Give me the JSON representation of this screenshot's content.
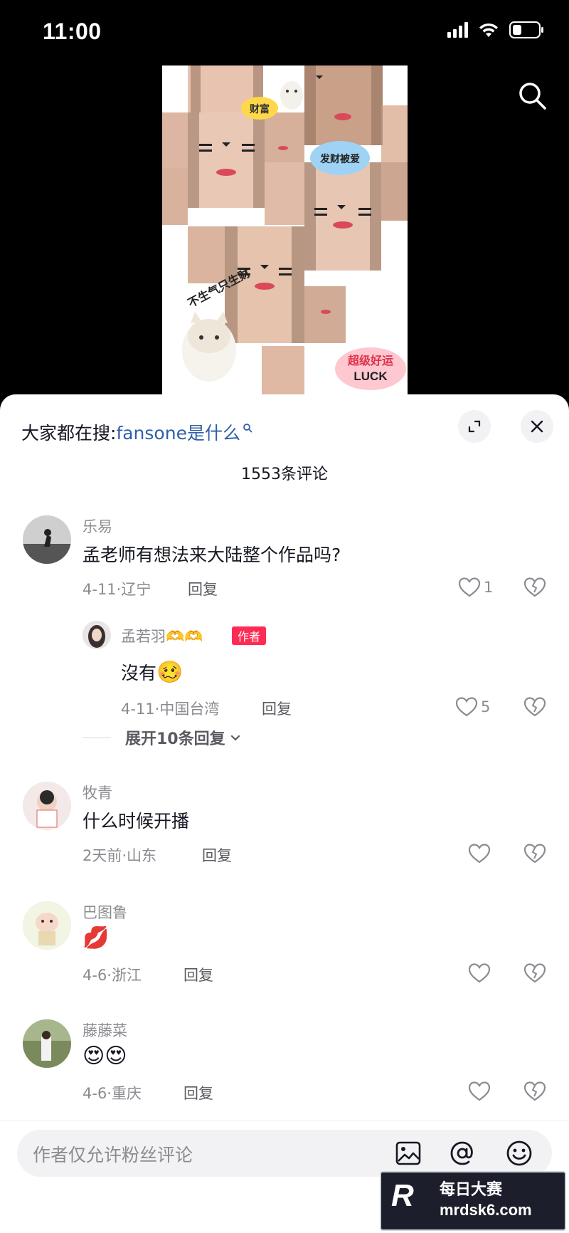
{
  "status_bar": {
    "time": "11:00"
  },
  "hot_search": {
    "prefix": "大家都在搜:",
    "term": "fansone是什么"
  },
  "comment_count": "1553条评论",
  "comments": [
    {
      "name": "乐易",
      "text": "孟老师有想法来大陆整个作品吗?",
      "meta": "4-11·辽宁",
      "reply_label": "回复",
      "likes": "1",
      "replies": [
        {
          "name": "孟若羽🫶🫶",
          "tag": "作者",
          "text": "沒有",
          "emoji": "🥴",
          "meta": "4-11·中国台湾",
          "reply_label": "回复",
          "likes": "5"
        }
      ],
      "expand_label": "展开10条回复"
    },
    {
      "name": "牧青",
      "text": "什么时候开播",
      "meta": "2天前·山东",
      "reply_label": "回复",
      "likes": ""
    },
    {
      "name": "巴图鲁",
      "text": "💋",
      "meta": "4-6·浙江",
      "reply_label": "回复",
      "likes": ""
    },
    {
      "name": "藤藤菜",
      "text": "😍😍",
      "meta": "4-6·重庆",
      "reply_label": "回复",
      "likes": ""
    }
  ],
  "input": {
    "placeholder": "作者仅允许粉丝评论"
  },
  "video_stickers": [
    "财富",
    "发财被爱",
    "不生气只生财",
    "超级好运",
    "LUCK"
  ],
  "watermark": {
    "logo": "R",
    "cn": "每日大赛",
    "en": "mrdsk6.com"
  },
  "colors": {
    "accent": "#fe2c55",
    "link": "#2f5fa8"
  }
}
